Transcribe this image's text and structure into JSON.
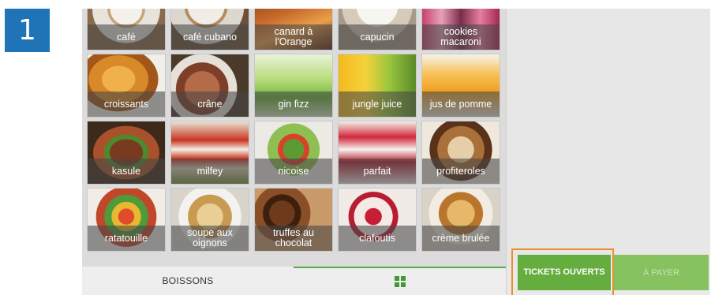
{
  "step_number": "1",
  "menu_items": [
    "café",
    "café cubano",
    "canard à l'Orange",
    "capucin",
    "cookies macaroni",
    "croissants",
    "crâne",
    "gin fizz",
    "jungle juice",
    "jus de pomme",
    "kasule",
    "milfey",
    "nicoise",
    "parfait",
    "profiteroles",
    "ratatouille",
    "soupe aux oignons",
    "truffes au chocolat",
    "clafoutis",
    "crème brulée"
  ],
  "bottom_tabs": {
    "boissons": "BOISSONS"
  },
  "buttons": {
    "tickets": "TICKETS OUVERTS",
    "payer": "À PAYER"
  },
  "colors": {
    "badge_blue": "#1f73b7",
    "tickets_green": "#66ad3f",
    "payer_green": "#86c25f",
    "highlight_orange": "#e8912c",
    "tab_indicator_green": "#5aa845"
  }
}
